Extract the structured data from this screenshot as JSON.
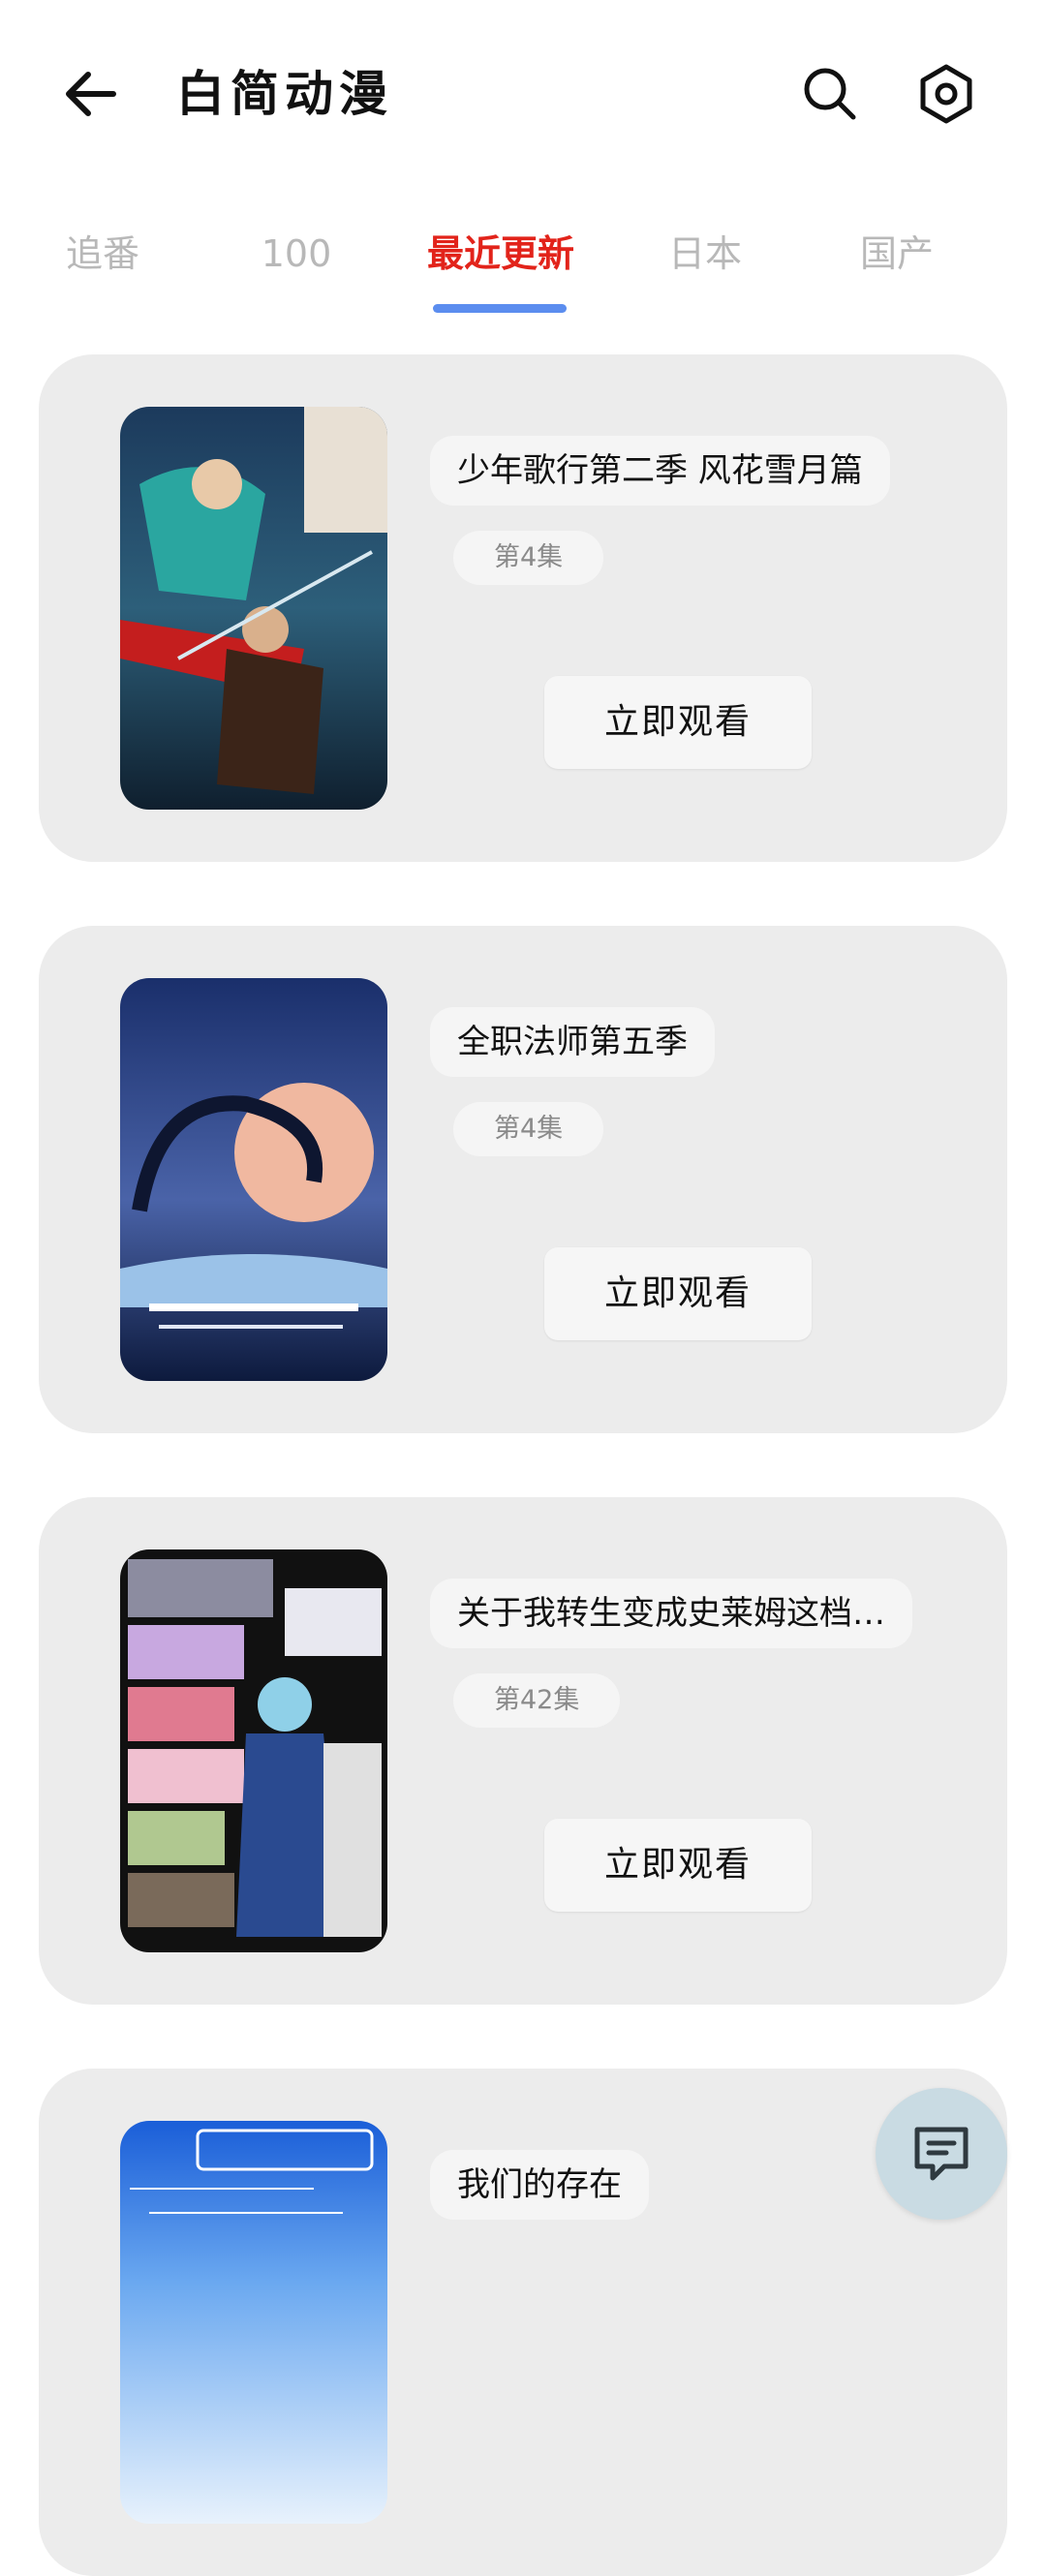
{
  "app": {
    "title": "白简动漫"
  },
  "tabs": [
    {
      "label": "追番"
    },
    {
      "label": "100"
    },
    {
      "label": "最近更新"
    },
    {
      "label": "日本"
    },
    {
      "label": "国产"
    }
  ],
  "active_tab": "最近更新",
  "colors": {
    "active_tab": "#e2231a",
    "indicator": "#5b8def",
    "card_bg": "#ececec"
  },
  "items": [
    {
      "title": "少年歌行第二季 风花雪月篇",
      "episode": "第4集",
      "watch_label": "立即观看"
    },
    {
      "title": "全职法师第五季",
      "episode": "第4集",
      "watch_label": "立即观看"
    },
    {
      "title": "关于我转生变成史莱姆这档…",
      "episode": "第42集",
      "watch_label": "立即观看"
    },
    {
      "title": "我们的存在",
      "episode": "",
      "watch_label": ""
    }
  ],
  "icons": {
    "back": "arrow-left-icon",
    "search": "search-icon",
    "settings": "gear-icon",
    "chat": "chat-bubble-icon"
  }
}
